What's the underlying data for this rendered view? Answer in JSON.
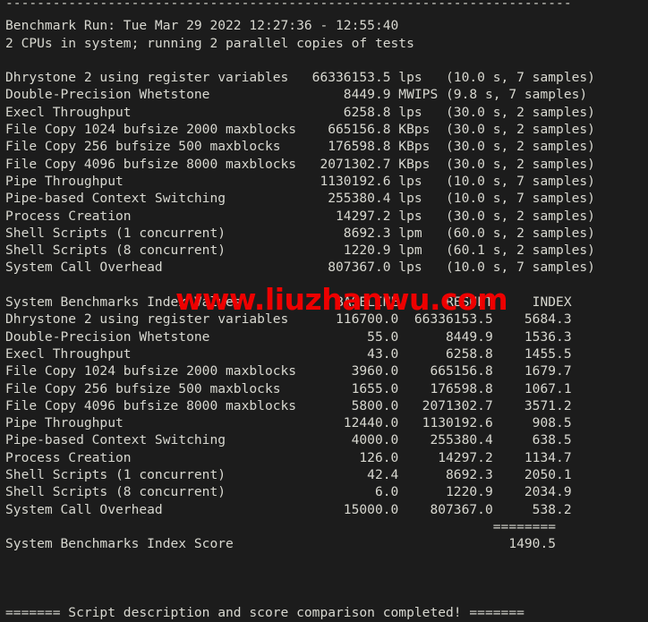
{
  "terminal": {
    "background_color": "#1c1c1c",
    "foreground_color": "#d8d8d0",
    "watermark_color": "#ee0000",
    "top_rule": "------------------------------------------------------------------------",
    "header": {
      "benchmark_run_line": "Benchmark Run: Tue Mar 29 2022 12:27:36 - 12:55:40",
      "cpu_line": "2 CPUs in system; running 2 parallel copies of tests"
    },
    "watermark_text": "www.liuzhanwu.com",
    "raw_results": [
      {
        "name": "Dhrystone 2 using register variables",
        "value": "66336153.5",
        "unit": "lps",
        "timing": "(10.0 s, 7 samples)"
      },
      {
        "name": "Double-Precision Whetstone",
        "value": "8449.9",
        "unit": "MWIPS",
        "timing": "(9.8 s, 7 samples)"
      },
      {
        "name": "Execl Throughput",
        "value": "6258.8",
        "unit": "lps",
        "timing": "(30.0 s, 2 samples)"
      },
      {
        "name": "File Copy 1024 bufsize 2000 maxblocks",
        "value": "665156.8",
        "unit": "KBps",
        "timing": "(30.0 s, 2 samples)"
      },
      {
        "name": "File Copy 256 bufsize 500 maxblocks",
        "value": "176598.8",
        "unit": "KBps",
        "timing": "(30.0 s, 2 samples)"
      },
      {
        "name": "File Copy 4096 bufsize 8000 maxblocks",
        "value": "2071302.7",
        "unit": "KBps",
        "timing": "(30.0 s, 2 samples)"
      },
      {
        "name": "Pipe Throughput",
        "value": "1130192.6",
        "unit": "lps",
        "timing": "(10.0 s, 7 samples)"
      },
      {
        "name": "Pipe-based Context Switching",
        "value": "255380.4",
        "unit": "lps",
        "timing": "(10.0 s, 7 samples)"
      },
      {
        "name": "Process Creation",
        "value": "14297.2",
        "unit": "lps",
        "timing": "(30.0 s, 2 samples)"
      },
      {
        "name": "Shell Scripts (1 concurrent)",
        "value": "8692.3",
        "unit": "lpm",
        "timing": "(60.0 s, 2 samples)"
      },
      {
        "name": "Shell Scripts (8 concurrent)",
        "value": "1220.9",
        "unit": "lpm",
        "timing": "(60.1 s, 2 samples)"
      },
      {
        "name": "System Call Overhead",
        "value": "807367.0",
        "unit": "lps",
        "timing": "(10.0 s, 7 samples)"
      }
    ],
    "index_table": {
      "title": "System Benchmarks Index Values",
      "columns": [
        "BASELINE",
        "RESULT",
        "INDEX"
      ],
      "rows": [
        {
          "name": "Dhrystone 2 using register variables",
          "baseline": "116700.0",
          "result": "66336153.5",
          "index": "5684.3"
        },
        {
          "name": "Double-Precision Whetstone",
          "baseline": "55.0",
          "result": "8449.9",
          "index": "1536.3"
        },
        {
          "name": "Execl Throughput",
          "baseline": "43.0",
          "result": "6258.8",
          "index": "1455.5"
        },
        {
          "name": "File Copy 1024 bufsize 2000 maxblocks",
          "baseline": "3960.0",
          "result": "665156.8",
          "index": "1679.7"
        },
        {
          "name": "File Copy 256 bufsize 500 maxblocks",
          "baseline": "1655.0",
          "result": "176598.8",
          "index": "1067.1"
        },
        {
          "name": "File Copy 4096 bufsize 8000 maxblocks",
          "baseline": "5800.0",
          "result": "2071302.7",
          "index": "3571.2"
        },
        {
          "name": "Pipe Throughput",
          "baseline": "12440.0",
          "result": "1130192.6",
          "index": "908.5"
        },
        {
          "name": "Pipe-based Context Switching",
          "baseline": "4000.0",
          "result": "255380.4",
          "index": "638.5"
        },
        {
          "name": "Process Creation",
          "baseline": "126.0",
          "result": "14297.2",
          "index": "1134.7"
        },
        {
          "name": "Shell Scripts (1 concurrent)",
          "baseline": "42.4",
          "result": "8692.3",
          "index": "2050.1"
        },
        {
          "name": "Shell Scripts (8 concurrent)",
          "baseline": "6.0",
          "result": "1220.9",
          "index": "2034.9"
        },
        {
          "name": "System Call Overhead",
          "baseline": "15000.0",
          "result": "807367.0",
          "index": "538.2"
        }
      ],
      "separator": "========",
      "total_label": "System Benchmarks Index Score",
      "total_value": "1490.5"
    },
    "footer": "======= Script description and score comparison completed! ======="
  }
}
